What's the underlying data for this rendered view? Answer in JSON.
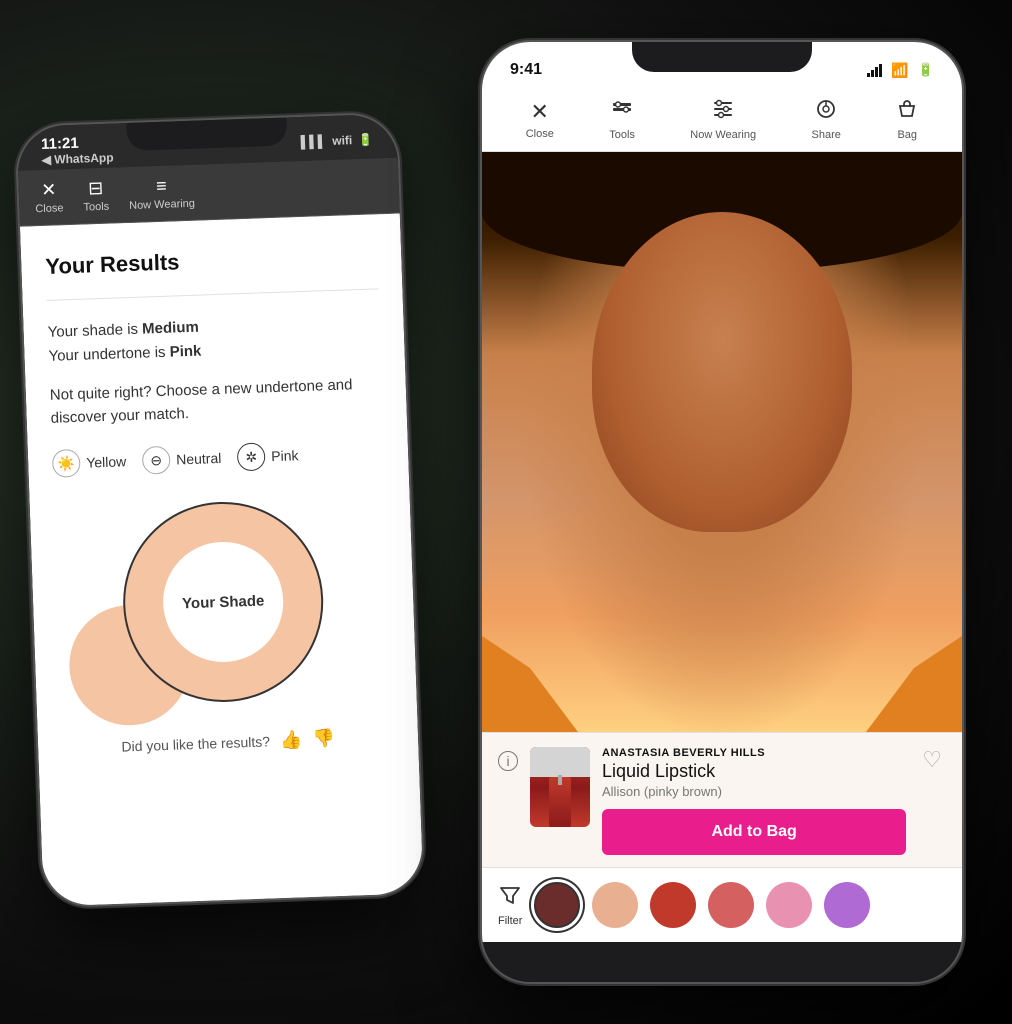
{
  "background": "#1a1a1a",
  "phone_back": {
    "status_time": "11:21",
    "status_arrow": "◀",
    "status_app": "WhatsApp",
    "nav": {
      "close_icon": "✕",
      "close_label": "Close",
      "tools_icon": "⊟",
      "tools_label": "Tools",
      "now_wearing_icon": "≡",
      "now_wearing_label": "Now Wearing"
    },
    "results": {
      "title": "Your Results",
      "shade_line1_prefix": "Your shade is ",
      "shade_bold": "Medium",
      "undertone_line2_prefix": "Your undertone is ",
      "undertone_bold": "Pink",
      "choose_text": "Not quite right? Choose a new undertone and discover your match.",
      "undertones": [
        {
          "id": "yellow",
          "label": "Yellow",
          "icon": "☀"
        },
        {
          "id": "neutral",
          "label": "Neutral",
          "icon": "⊖"
        },
        {
          "id": "pink",
          "label": "Pink",
          "icon": "✲"
        }
      ],
      "shade_label": "Your Shade",
      "did_you_like": "Did you like the results?"
    }
  },
  "phone_front": {
    "status_time": "9:41",
    "nav": {
      "close_icon": "✕",
      "close_label": "Close",
      "tools_icon": "⊞",
      "tools_label": "Tools",
      "now_wearing_icon": "≡",
      "now_wearing_label": "Now Wearing",
      "share_icon": "⊙",
      "share_label": "Share",
      "bag_icon": "⊔",
      "bag_label": "Bag"
    },
    "product": {
      "brand": "ANASTASIA BEVERLY HILLS",
      "name": "Liquid Lipstick",
      "shade": "Allison (pinky brown)",
      "add_to_bag": "Add to Bag"
    },
    "swatches": [
      {
        "color": "#6b2c2c",
        "active": true
      },
      {
        "color": "#e8b090",
        "active": false
      },
      {
        "color": "#c0392b",
        "active": false
      },
      {
        "color": "#d46060",
        "active": false
      },
      {
        "color": "#e891b0",
        "active": false
      },
      {
        "color": "#b06ad4",
        "active": false
      }
    ],
    "filter_label": "Filter"
  }
}
